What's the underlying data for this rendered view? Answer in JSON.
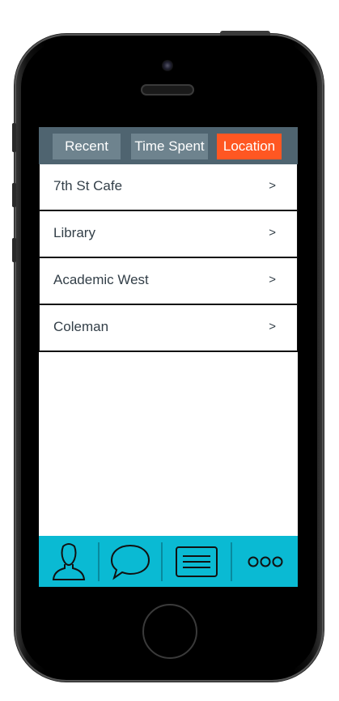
{
  "tabs": {
    "recent": "Recent",
    "time_spent": "Time Spent",
    "location": "Location",
    "active": "location"
  },
  "locations": [
    {
      "name": "7th St Cafe",
      "chevron": ">"
    },
    {
      "name": "Library",
      "chevron": ">"
    },
    {
      "name": "Academic West",
      "chevron": ">"
    },
    {
      "name": "Coleman",
      "chevron": ">"
    }
  ],
  "bottom_nav": {
    "icons": [
      "profile-icon",
      "chat-icon",
      "list-icon",
      "more-icon"
    ]
  },
  "colors": {
    "tab_bar": "#4f6470",
    "tab_inactive": "#6e838e",
    "tab_active": "#ff5722",
    "bottom_bar": "#0abad3"
  }
}
